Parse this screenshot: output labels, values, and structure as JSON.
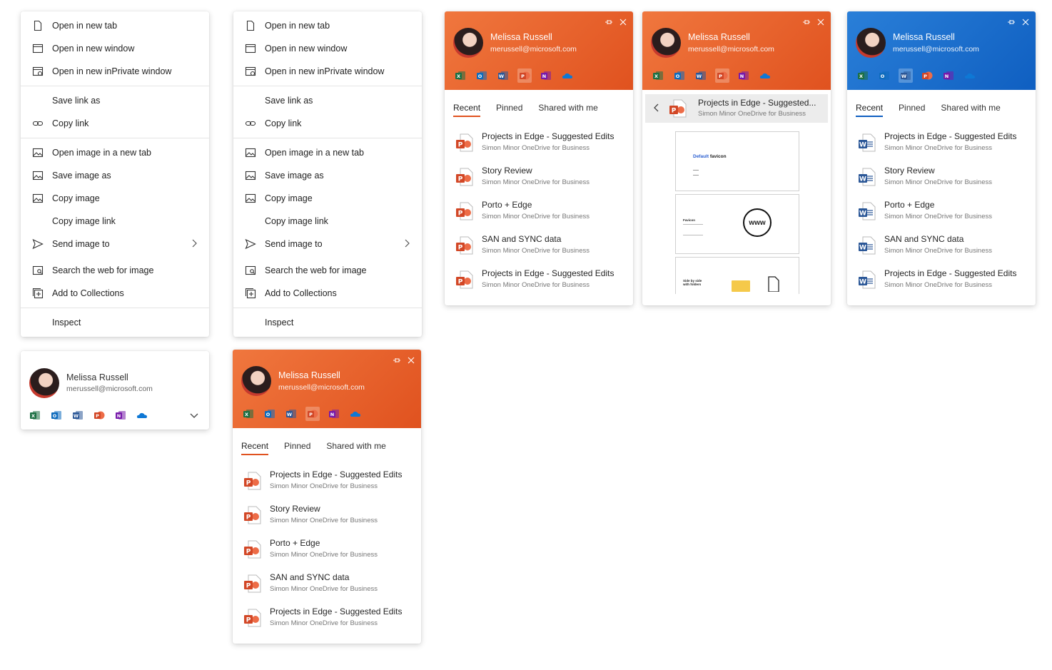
{
  "context_menu": {
    "items": [
      {
        "label": "Open in new tab",
        "icon": "page-icon"
      },
      {
        "label": "Open in new window",
        "icon": "window-icon"
      },
      {
        "label": "Open in new inPrivate window",
        "icon": "inprivate-icon"
      },
      {
        "label": "Save link as",
        "icon": ""
      },
      {
        "label": "Copy link",
        "icon": "link-icon"
      },
      {
        "label": "Open image in a new tab",
        "icon": "image-icon"
      },
      {
        "label": "Save image as",
        "icon": "image-icon"
      },
      {
        "label": "Copy image",
        "icon": "image-icon"
      },
      {
        "label": "Copy image link",
        "icon": ""
      },
      {
        "label": "Send image to",
        "icon": "send-icon"
      },
      {
        "label": "Search the web for image",
        "icon": "image-search-icon"
      },
      {
        "label": "Add to Collections",
        "icon": "collections-icon"
      },
      {
        "label": "Inspect",
        "icon": ""
      }
    ]
  },
  "profile": {
    "name": "Melissa Russell",
    "email": "merussell@microsoft.com"
  },
  "apps": [
    "excel-icon",
    "outlook-icon",
    "word-icon",
    "powerpoint-icon",
    "onenote-icon",
    "onedrive-icon"
  ],
  "tabs": [
    "Recent",
    "Pinned",
    "Shared with me"
  ],
  "files": [
    {
      "title": "Projects in Edge - Suggested Edits",
      "source": "Simon Minor OneDrive for Business"
    },
    {
      "title": "Story Review",
      "source": "Simon Minor OneDrive for Business"
    },
    {
      "title": "Porto + Edge",
      "source": "Simon Minor OneDrive for Business"
    },
    {
      "title": "SAN and SYNC data",
      "source": "Simon Minor OneDrive for Business"
    },
    {
      "title": "Projects in Edge - Suggested Edits",
      "source": "Simon Minor OneDrive for Business"
    }
  ],
  "preview": {
    "title": "Projects in Edge - Suggested...",
    "source": "Simon Minor OneDrive for Business",
    "slide1_title_accent": "Default",
    "slide1_title": "favicon",
    "slide2_heading": "Favicon",
    "slide2_badge": "www",
    "slide3_heading": "Side by side with folders"
  },
  "colors": {
    "orange": "#e0521f",
    "blue": "#0f5fc1",
    "excel": "#1d7044",
    "outlook": "#0f6cbd",
    "word": "#2b5797",
    "powerpoint": "#d24726",
    "onenote": "#7719aa",
    "onedrive": "#0e78d5"
  }
}
